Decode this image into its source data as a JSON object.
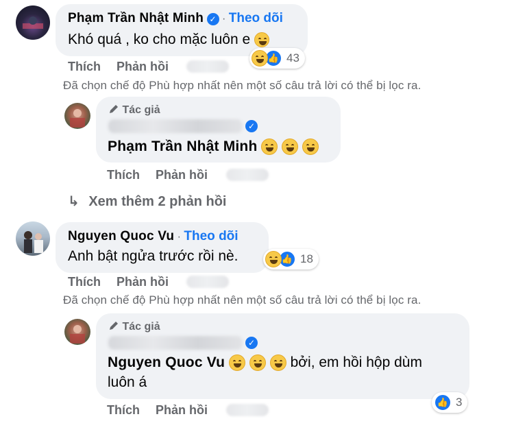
{
  "comments": [
    {
      "author": "Phạm Trần Nhật Minh",
      "follow_label": "Theo dõi",
      "separator": "·",
      "text": "Khó quá , ko cho mặc luôn e",
      "reaction_count": "43",
      "like_label": "Thích",
      "reply_label": "Phản hồi",
      "filter_note": "Đã chọn chế độ Phù hợp nhất nên một số câu trả lời có thể bị lọc ra.",
      "reply": {
        "author_tag": "Tác giả",
        "mention": "Phạm Trần Nhật Minh",
        "text": "",
        "like_label": "Thích",
        "reply_label": "Phản hồi"
      },
      "more_replies": "Xem thêm 2 phản hồi"
    },
    {
      "author": "Nguyen Quoc Vu",
      "follow_label": "Theo dõi",
      "separator": "·",
      "text": "Anh bật ngửa trước rồi nè.",
      "reaction_count": "18",
      "like_label": "Thích",
      "reply_label": "Phản hồi",
      "filter_note": "Đã chọn chế độ Phù hợp nhất nên một số câu trả lời có thể bị lọc ra.",
      "reply": {
        "author_tag": "Tác giả",
        "mention": "Nguyen Quoc Vu",
        "text_line1": "bởi, em hồi hộp dùm",
        "text_line2": "luôn á",
        "reaction_count": "3",
        "like_label": "Thích",
        "reply_label": "Phản hồi"
      }
    }
  ],
  "icons": {
    "verified": "verified-badge-icon",
    "pencil": "pencil-icon",
    "reply_arrow": "reply-arrow-icon",
    "haha": "haha-emoji-icon",
    "like": "like-icon"
  },
  "colors": {
    "link": "#1877f2",
    "bubble": "#f0f2f5",
    "muted": "#65676b"
  }
}
